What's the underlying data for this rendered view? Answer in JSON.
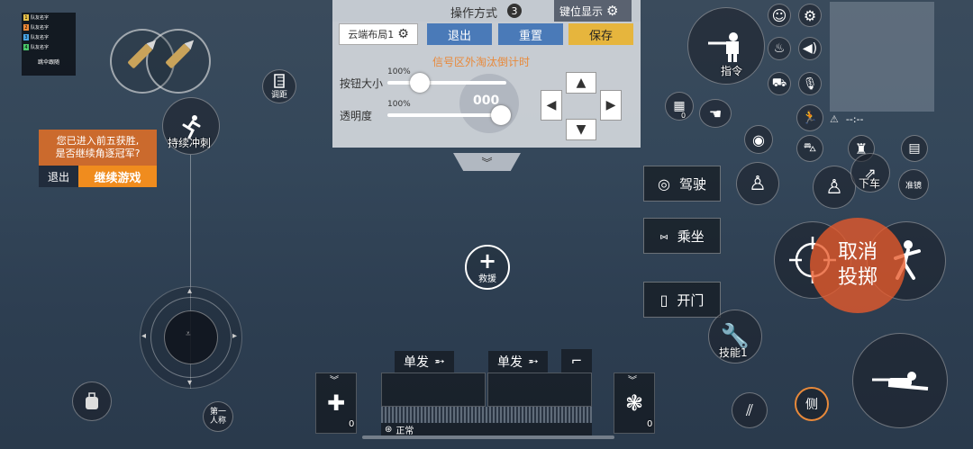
{
  "team": {
    "members": [
      {
        "num": "1",
        "name": "队友名字",
        "color": "#e8c14a"
      },
      {
        "num": "2",
        "name": "队友名字",
        "color": "#f08c3a"
      },
      {
        "num": "3",
        "name": "队友名字",
        "color": "#4aa6e8"
      },
      {
        "num": "4",
        "name": "队友名字",
        "color": "#4ac86a"
      }
    ],
    "footer": "跳伞跟随"
  },
  "left": {
    "adjust_label": "调距",
    "sprint_label": "持续冲刺",
    "first_person_label": "第一\n人称",
    "prompt": {
      "text": "您已进入前五获胜,\n是否继续角逐冠军?",
      "exit": "退出",
      "continue": "继续游戏"
    }
  },
  "panel": {
    "title": "操作方式",
    "badge": "3",
    "keypos": "键位显示",
    "layout_select": "云端布局1",
    "exit": "退出",
    "reset": "重置",
    "save": "保存",
    "signal": "信号区外淘汰倒计时",
    "size_label": "按钮大小",
    "size_pct": "100%",
    "opacity_label": "透明度",
    "opacity_pct": "100%",
    "center_value": "000"
  },
  "center": {
    "rescue_label": "救援"
  },
  "vehicle": {
    "drive": "驾驶",
    "ride": "乘坐",
    "door": "开门"
  },
  "right": {
    "command": "指令",
    "exit_vehicle": "下车",
    "aim": "准镜",
    "cancel_throw": "取消\n投掷",
    "skill": "技能1",
    "side": "侧",
    "minimap_time": "--:--",
    "items_count": "0"
  },
  "bottom": {
    "fire_mode_1": "单发",
    "fire_mode_2": "单发",
    "status": "正常",
    "medkit_count": "0",
    "grenade_count": "0"
  },
  "colors": {
    "accent_orange": "#e85a2a",
    "save_gold": "#e6b53d",
    "button_blue": "#4a7ab8"
  }
}
